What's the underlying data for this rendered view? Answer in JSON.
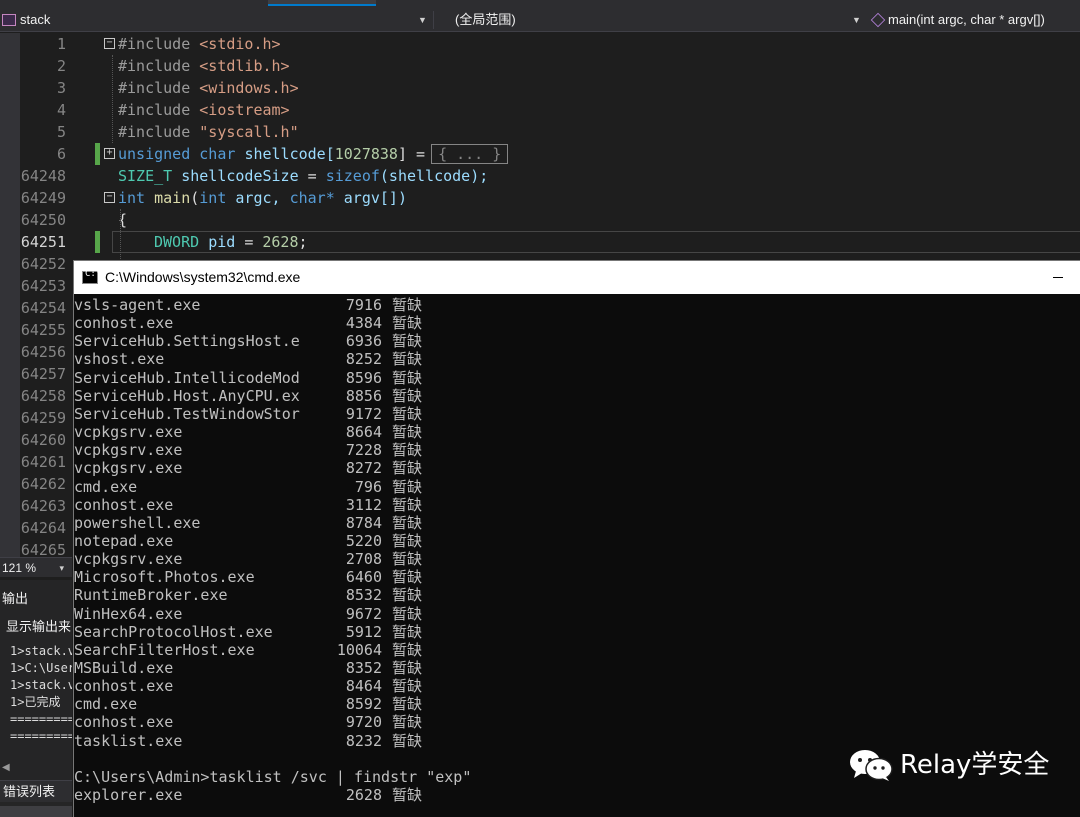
{
  "nav": {
    "project": "stack",
    "scope": "(全局范围)",
    "member": "main(int argc, char * argv[])"
  },
  "editor": {
    "line_numbers": [
      "1",
      "2",
      "3",
      "4",
      "5",
      "6",
      "64248",
      "64249",
      "64250",
      "64251",
      "64252",
      "64253",
      "64254",
      "64255",
      "64256",
      "64257",
      "64258",
      "64259",
      "64260",
      "64261",
      "64262",
      "64263",
      "64264",
      "64265"
    ],
    "current_line": "64251",
    "code": {
      "l1_kw": "#include",
      "l1_hdr": "<stdio.h>",
      "l2_kw": "#include",
      "l2_hdr": "<stdlib.h>",
      "l3_kw": "#include",
      "l3_hdr": "<windows.h>",
      "l4_kw": "#include",
      "l4_hdr": "<iostream>",
      "l5_kw": "#include",
      "l5_hdr": "\"syscall.h\"",
      "l6_type1": "unsigned",
      "l6_type2": "char",
      "l6_name": "shellcode[",
      "l6_num": "1027838",
      "l6_rest": "] =",
      "l6_collapsed": "{ ... }",
      "l7_type": "SIZE_T",
      "l7_name": "shellcodeSize",
      "l7_eq": "=",
      "l7_fn": "sizeof",
      "l7_arg": "(shellcode);",
      "l8_type": "int",
      "l8_fn": "main",
      "l8_p1": "(",
      "l8_t1": "int",
      "l8_a1": "argc,",
      "l8_t2": "char*",
      "l8_a2": "argv[])",
      "l9": "{",
      "l10_type": "DWORD",
      "l10_var": "pid",
      "l10_eq": "=",
      "l10_num": "2628",
      "l10_end": ";"
    }
  },
  "zoom": {
    "level": "121 %"
  },
  "output": {
    "title": "输出",
    "source_label": "显示输出来",
    "lines": [
      "1>stack.v",
      "1>C:\\User",
      "1>stack.v",
      "1>已完成",
      "=========",
      "========="
    ],
    "error_tab": "错误列表"
  },
  "cmd": {
    "title": "C:\\Windows\\system32\\cmd.exe",
    "rows": [
      {
        "name": "vsls-agent.exe",
        "pid": "7916",
        "svc": "暂缺"
      },
      {
        "name": "conhost.exe",
        "pid": "4384",
        "svc": "暂缺"
      },
      {
        "name": "ServiceHub.SettingsHost.e",
        "pid": "6936",
        "svc": "暂缺"
      },
      {
        "name": "vshost.exe",
        "pid": "8252",
        "svc": "暂缺"
      },
      {
        "name": "ServiceHub.IntellicodeMod",
        "pid": "8596",
        "svc": "暂缺"
      },
      {
        "name": "ServiceHub.Host.AnyCPU.ex",
        "pid": "8856",
        "svc": "暂缺"
      },
      {
        "name": "ServiceHub.TestWindowStor",
        "pid": "9172",
        "svc": "暂缺"
      },
      {
        "name": "vcpkgsrv.exe",
        "pid": "8664",
        "svc": "暂缺"
      },
      {
        "name": "vcpkgsrv.exe",
        "pid": "7228",
        "svc": "暂缺"
      },
      {
        "name": "vcpkgsrv.exe",
        "pid": "8272",
        "svc": "暂缺"
      },
      {
        "name": "cmd.exe",
        "pid": "796",
        "svc": "暂缺"
      },
      {
        "name": "conhost.exe",
        "pid": "3112",
        "svc": "暂缺"
      },
      {
        "name": "powershell.exe",
        "pid": "8784",
        "svc": "暂缺"
      },
      {
        "name": "notepad.exe",
        "pid": "5220",
        "svc": "暂缺"
      },
      {
        "name": "vcpkgsrv.exe",
        "pid": "2708",
        "svc": "暂缺"
      },
      {
        "name": "Microsoft.Photos.exe",
        "pid": "6460",
        "svc": "暂缺"
      },
      {
        "name": "RuntimeBroker.exe",
        "pid": "8532",
        "svc": "暂缺"
      },
      {
        "name": "WinHex64.exe",
        "pid": "9672",
        "svc": "暂缺"
      },
      {
        "name": "SearchProtocolHost.exe",
        "pid": "5912",
        "svc": "暂缺"
      },
      {
        "name": "SearchFilterHost.exe",
        "pid": "10064",
        "svc": "暂缺"
      },
      {
        "name": "MSBuild.exe",
        "pid": "8352",
        "svc": "暂缺"
      },
      {
        "name": "conhost.exe",
        "pid": "8464",
        "svc": "暂缺"
      },
      {
        "name": "cmd.exe",
        "pid": "8592",
        "svc": "暂缺"
      },
      {
        "name": "conhost.exe",
        "pid": "9720",
        "svc": "暂缺"
      },
      {
        "name": "tasklist.exe",
        "pid": "8232",
        "svc": "暂缺"
      }
    ],
    "prompt_line": "C:\\Users\\Admin>tasklist /svc | findstr \"exp\"",
    "result_row": {
      "name": "explorer.exe",
      "pid": "2628",
      "svc": "暂缺"
    }
  },
  "watermark": {
    "text": "Relay学安全"
  }
}
